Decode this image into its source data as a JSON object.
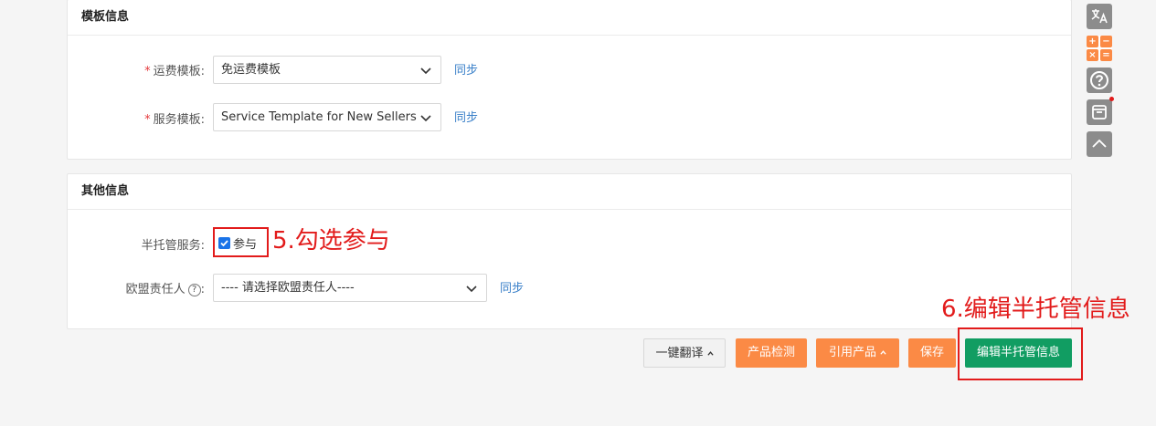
{
  "template_section": {
    "title": "模板信息",
    "shipping": {
      "label": "运费模板:",
      "value": "免运费模板",
      "sync": "同步"
    },
    "service": {
      "label": "服务模板:",
      "value": "Service Template for New Sellers",
      "sync": "同步"
    }
  },
  "other_section": {
    "title": "其他信息",
    "semi_managed": {
      "label": "半托管服务:",
      "checkbox_label": "参与",
      "checked": true
    },
    "eu_rep": {
      "label": "欧盟责任人",
      "label_suffix": ":",
      "help": "?",
      "value": "---- 请选择欧盟责任人----",
      "sync": "同步"
    }
  },
  "annotations": {
    "step5": "5.勾选参与",
    "step6": "6.编辑半托管信息"
  },
  "buttons": {
    "translate": "一键翻译",
    "detect": "产品检测",
    "quote": "引用产品",
    "save": "保存",
    "edit_semi": "编辑半托管信息"
  },
  "side_tools": {
    "translate_icon": "translate-icon",
    "calculator": [
      "+",
      "−",
      "×",
      "="
    ],
    "help_icon": "help-icon",
    "archive_icon": "archive-icon",
    "top_icon": "scroll-top-icon"
  },
  "colors": {
    "orange": "#fb8a45",
    "green": "#119d62",
    "annotation_red": "#e21b1b",
    "link_blue": "#3a80c9"
  }
}
